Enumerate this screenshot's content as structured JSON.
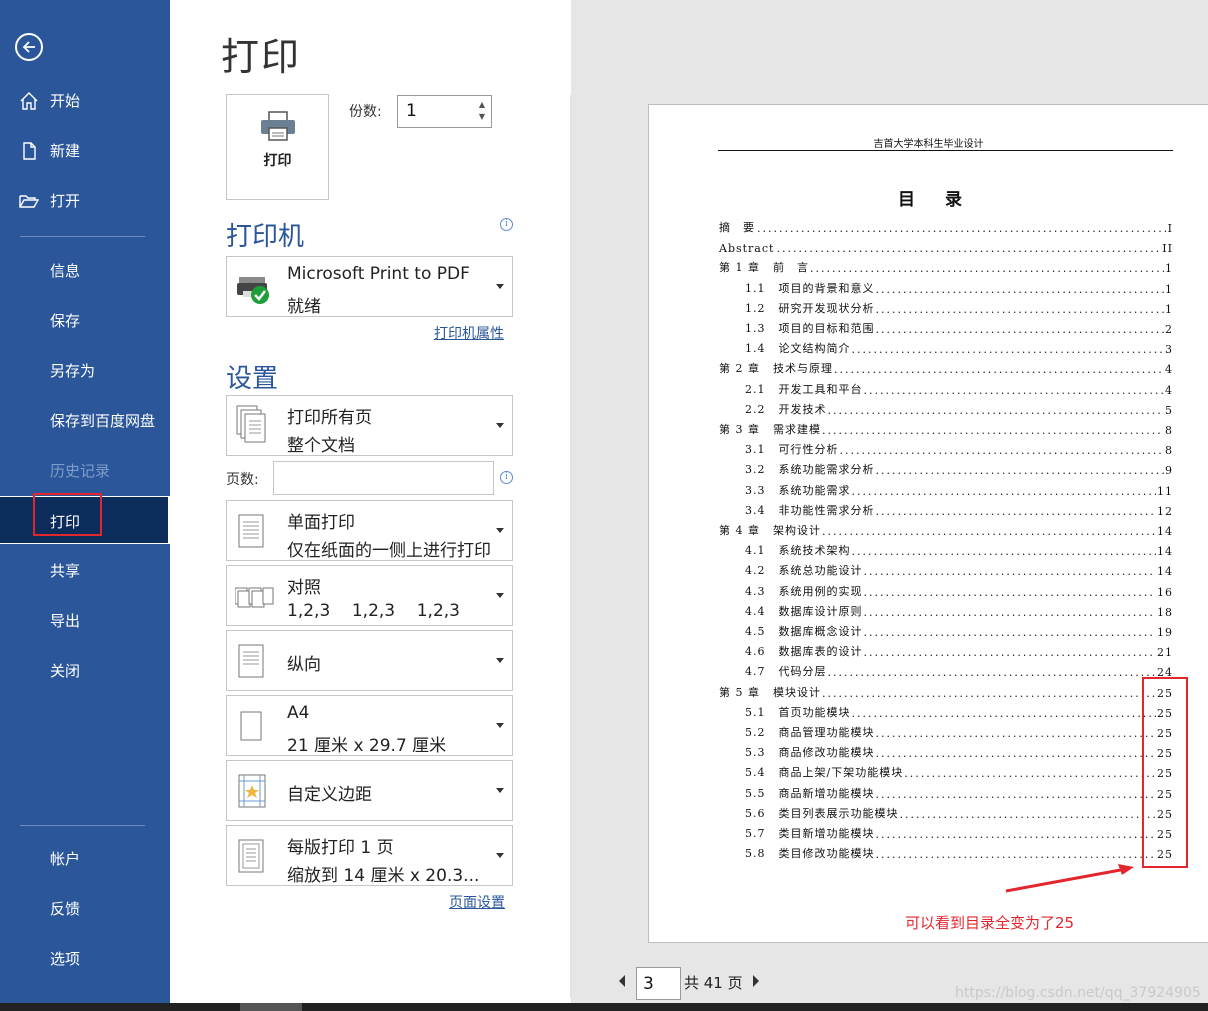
{
  "title": "打印",
  "sidebar": {
    "items": [
      {
        "label": "开始"
      },
      {
        "label": "新建"
      },
      {
        "label": "打开"
      },
      {
        "label": "信息"
      },
      {
        "label": "保存"
      },
      {
        "label": "另存为"
      },
      {
        "label": "保存到百度网盘"
      },
      {
        "label": "历史记录"
      },
      {
        "label": "打印"
      },
      {
        "label": "共享"
      },
      {
        "label": "导出"
      },
      {
        "label": "关闭"
      },
      {
        "label": "帐户"
      },
      {
        "label": "反馈"
      },
      {
        "label": "选项"
      }
    ]
  },
  "print": {
    "button_label": "打印",
    "copies_label": "份数:",
    "copies_value": "1"
  },
  "printer": {
    "heading": "打印机",
    "name": "Microsoft Print to PDF",
    "status": "就绪",
    "properties_link": "打印机属性"
  },
  "settings": {
    "heading": "设置",
    "range_l1": "打印所有页",
    "range_l2": "整个文档",
    "pages_label": "页数:",
    "pages_value": "",
    "sides_l1": "单面打印",
    "sides_l2": "仅在纸面的一侧上进行打印",
    "collate_l1": "对照",
    "collate_l2": "1,2,3    1,2,3    1,2,3",
    "orientation": "纵向",
    "paper_l1": "A4",
    "paper_l2": "21 厘米 x 29.7 厘米",
    "margins": "自定义边距",
    "perpage_l1": "每版打印 1 页",
    "perpage_l2": "缩放到 14 厘米 x 20.3...",
    "page_setup_link": "页面设置"
  },
  "preview": {
    "header": "吉首大学本科生毕业设计",
    "toc_title": "目录",
    "toc": [
      {
        "num": "摘　要",
        "title": "",
        "page": "I",
        "lvl": 1
      },
      {
        "num": "Abstract",
        "title": "",
        "page": "II",
        "lvl": 1
      },
      {
        "num": "第 1 章",
        "title": "前　言",
        "page": "1",
        "lvl": 1
      },
      {
        "num": "1.1",
        "title": "项目的背景和意义",
        "page": "1",
        "lvl": 2
      },
      {
        "num": "1.2",
        "title": "研究开发现状分析",
        "page": "1",
        "lvl": 2
      },
      {
        "num": "1.3",
        "title": "项目的目标和范围",
        "page": "2",
        "lvl": 2
      },
      {
        "num": "1.4",
        "title": "论文结构简介",
        "page": "3",
        "lvl": 2
      },
      {
        "num": "第 2 章",
        "title": "技术与原理",
        "page": "4",
        "lvl": 1
      },
      {
        "num": "2.1",
        "title": "开发工具和平台",
        "page": "4",
        "lvl": 2
      },
      {
        "num": "2.2",
        "title": "开发技术",
        "page": "5",
        "lvl": 2
      },
      {
        "num": "第 3 章",
        "title": "需求建模",
        "page": "8",
        "lvl": 1
      },
      {
        "num": "3.1",
        "title": "可行性分析",
        "page": "8",
        "lvl": 2
      },
      {
        "num": "3.2",
        "title": "系统功能需求分析",
        "page": "9",
        "lvl": 2
      },
      {
        "num": "3.3",
        "title": "系统功能需求",
        "page": "11",
        "lvl": 2
      },
      {
        "num": "3.4",
        "title": "非功能性需求分析",
        "page": "12",
        "lvl": 2
      },
      {
        "num": "第 4 章",
        "title": "架构设计",
        "page": "14",
        "lvl": 1
      },
      {
        "num": "4.1",
        "title": "系统技术架构",
        "page": "14",
        "lvl": 2
      },
      {
        "num": "4.2",
        "title": "系统总功能设计",
        "page": "14",
        "lvl": 2
      },
      {
        "num": "4.3",
        "title": "系统用例的实现",
        "page": "16",
        "lvl": 2
      },
      {
        "num": "4.4",
        "title": "数据库设计原则",
        "page": "18",
        "lvl": 2
      },
      {
        "num": "4.5",
        "title": "数据库概念设计",
        "page": "19",
        "lvl": 2
      },
      {
        "num": "4.6",
        "title": "数据库表的设计",
        "page": "21",
        "lvl": 2
      },
      {
        "num": "4.7",
        "title": "代码分层",
        "page": "24",
        "lvl": 2
      },
      {
        "num": "第 5 章",
        "title": "模块设计",
        "page": "25",
        "lvl": 1
      },
      {
        "num": "5.1",
        "title": "首页功能模块",
        "page": "25",
        "lvl": 2
      },
      {
        "num": "5.2",
        "title": "商品管理功能模块",
        "page": "25",
        "lvl": 2
      },
      {
        "num": "5.3",
        "title": "商品修改功能模块",
        "page": "25",
        "lvl": 2
      },
      {
        "num": "5.4",
        "title": "商品上架/下架功能模块",
        "page": "25",
        "lvl": 2
      },
      {
        "num": "5.5",
        "title": "商品新增功能模块",
        "page": "25",
        "lvl": 2
      },
      {
        "num": "5.6",
        "title": "类目列表展示功能模块",
        "page": "25",
        "lvl": 2
      },
      {
        "num": "5.7",
        "title": "类目新增功能模块",
        "page": "25",
        "lvl": 2
      },
      {
        "num": "5.8",
        "title": "类目修改功能模块",
        "page": "25",
        "lvl": 2
      }
    ],
    "annotation": "可以看到目录全变为了25",
    "current_page": "3",
    "total_pages": "共 41 页"
  },
  "watermark": "https://blog.csdn.net/qq_37924905",
  "colors": {
    "sidebar": "#2b579a",
    "active": "#0c2c5c",
    "annotation": "#e3262d"
  }
}
